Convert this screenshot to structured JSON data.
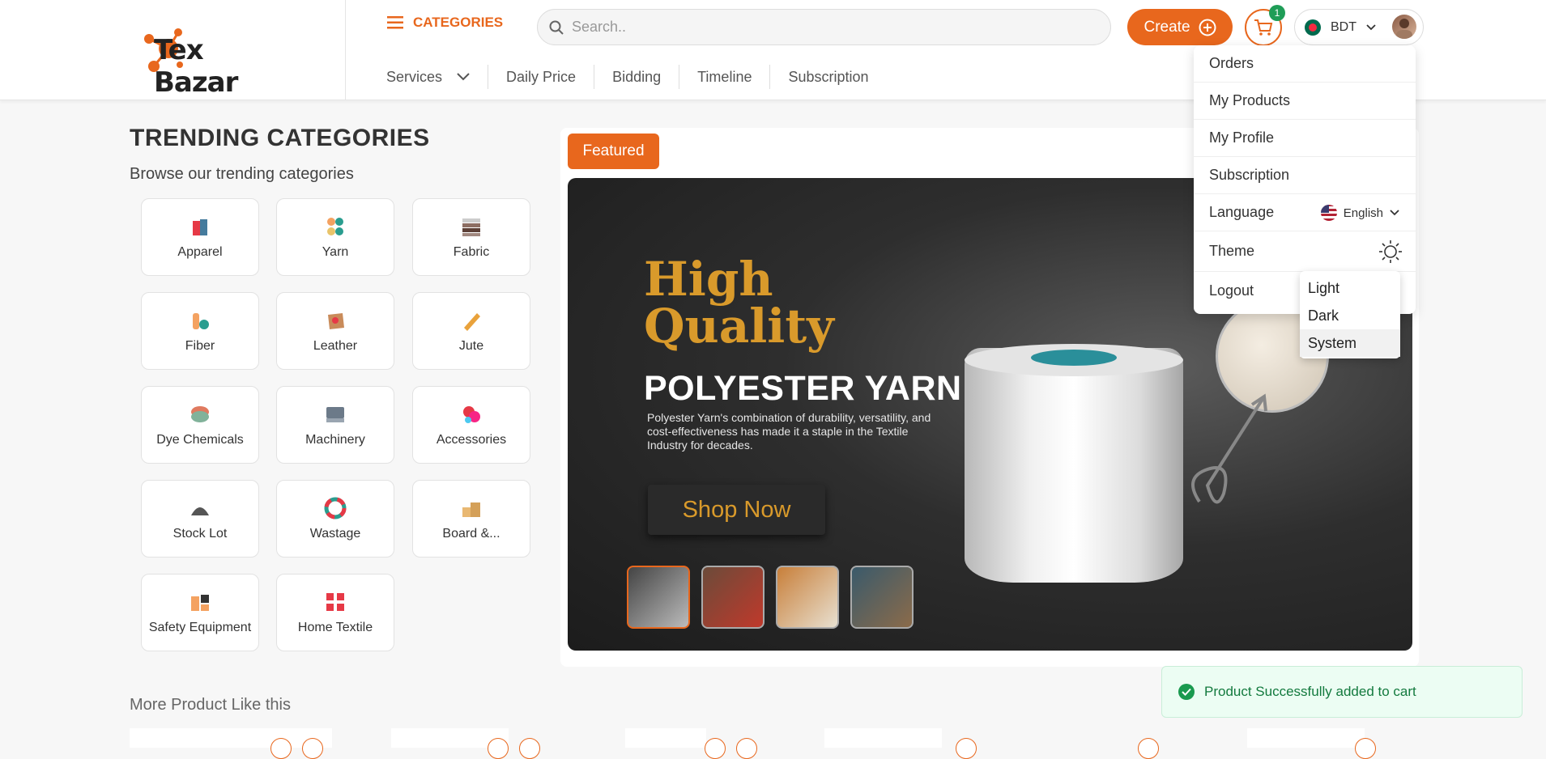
{
  "header": {
    "logo_text": "Tex Bazar",
    "categories_label": "CATEGORIES",
    "search_placeholder": "Search..",
    "create_label": "Create",
    "cart_count": "1",
    "currency": "BDT",
    "nav": [
      {
        "label": "Services"
      },
      {
        "label": "Daily Price"
      },
      {
        "label": "Bidding"
      },
      {
        "label": "Timeline"
      },
      {
        "label": "Subscription"
      }
    ]
  },
  "trending": {
    "title": "TRENDING CATEGORIES",
    "subtitle": "Browse our trending categories",
    "categories": [
      {
        "label": "Apparel",
        "icon": "apparel-icon"
      },
      {
        "label": "Yarn",
        "icon": "yarn-icon"
      },
      {
        "label": "Fabric",
        "icon": "fabric-icon"
      },
      {
        "label": "Fiber",
        "icon": "fiber-icon"
      },
      {
        "label": "Leather",
        "icon": "leather-icon"
      },
      {
        "label": "Jute",
        "icon": "jute-icon"
      },
      {
        "label": "Dye Chemicals",
        "icon": "dye-chemicals-icon"
      },
      {
        "label": "Machinery",
        "icon": "machinery-icon"
      },
      {
        "label": "Accessories",
        "icon": "accessories-icon"
      },
      {
        "label": "Stock Lot",
        "icon": "stock-lot-icon"
      },
      {
        "label": "Wastage",
        "icon": "wastage-icon"
      },
      {
        "label": "Board &...",
        "icon": "board-icon"
      },
      {
        "label": "Safety Equipment",
        "icon": "safety-equipment-icon"
      },
      {
        "label": "Home Textile",
        "icon": "home-textile-icon"
      }
    ]
  },
  "featured": {
    "tag": "Featured",
    "banner": {
      "headline_line1": "High",
      "headline_line2": "Quality",
      "title": "POLYESTER YARN",
      "description": "Polyester Yarn's combination of durability, versatility, and cost-effectiveness has made it a staple in the Textile Industry for decades.",
      "cta": "Shop Now"
    },
    "thumbnail_count": 4,
    "active_thumbnail": 1
  },
  "user_menu": {
    "items": [
      "Orders",
      "My Products",
      "My Profile",
      "Subscription"
    ],
    "language_label": "Language",
    "language_value": "English",
    "theme_label": "Theme",
    "logout_label": "Logout"
  },
  "theme_menu": {
    "options": [
      "Light",
      "Dark",
      "System"
    ],
    "selected": "System"
  },
  "more_products": {
    "title": "More Product Like this"
  },
  "toast": {
    "message": "Product Successfully added to cart"
  },
  "colors": {
    "accent": "#e8671d",
    "success": "#1a9a4f",
    "badge": "#1f9d57"
  }
}
